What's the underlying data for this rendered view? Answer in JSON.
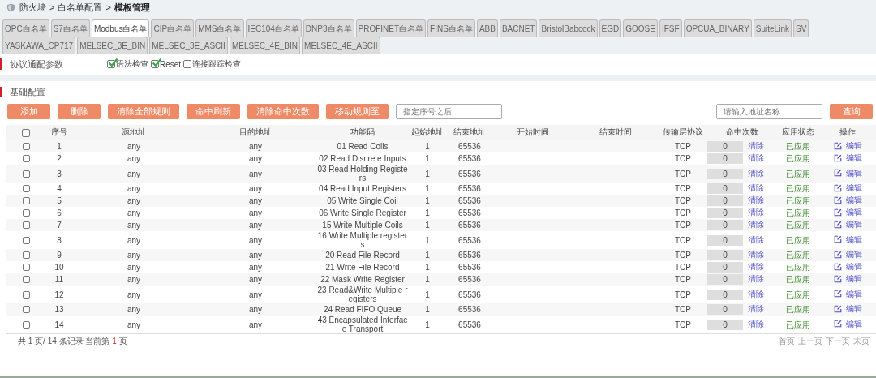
{
  "breadcrumb": {
    "separator": ">",
    "items": [
      {
        "label": "防火墙",
        "current": false
      },
      {
        "label": "白名单配置",
        "current": false
      },
      {
        "label": "模板管理",
        "current": true
      }
    ]
  },
  "tab_rows": [
    [
      {
        "label": "OPC白名单",
        "selected": false
      },
      {
        "label": "S7白名单",
        "selected": false
      },
      {
        "label": "Modbus白名单",
        "selected": true
      },
      {
        "label": "CIP白名单",
        "selected": false
      },
      {
        "label": "MMS白名单",
        "selected": false
      },
      {
        "label": "IEC104白名单",
        "selected": false
      },
      {
        "label": "DNP3白名单",
        "selected": false
      },
      {
        "label": "PROFINET白名单",
        "selected": false
      },
      {
        "label": "FINS白名单",
        "selected": false
      },
      {
        "label": "ABB",
        "selected": false
      },
      {
        "label": "BACNET",
        "selected": false
      },
      {
        "label": "BristolBabcock",
        "selected": false
      },
      {
        "label": "EGD",
        "selected": false
      },
      {
        "label": "GOOSE",
        "selected": false
      },
      {
        "label": "IFSF",
        "selected": false
      },
      {
        "label": "OPCUA_BINARY",
        "selected": false
      },
      {
        "label": "SuiteLink",
        "selected": false
      },
      {
        "label": "SV",
        "selected": false
      }
    ],
    [
      {
        "label": "YASKAWA_CP717",
        "selected": false
      },
      {
        "label": "MELSEC_3E_BIN",
        "selected": false
      },
      {
        "label": "MELSEC_3E_ASCII",
        "selected": false
      },
      {
        "label": "MELSEC_4E_BIN",
        "selected": false
      },
      {
        "label": "MELSEC_4E_ASCII",
        "selected": false
      }
    ]
  ],
  "protocol_params": {
    "title": "协议通配参数",
    "options": [
      {
        "label": "语法检查",
        "checked": true
      },
      {
        "label": "Reset",
        "checked": true
      },
      {
        "label": "连接跟踪检查",
        "checked": false
      }
    ]
  },
  "basic_config": {
    "title": "基础配置",
    "buttons": [
      "添加",
      "删除",
      "清除全部规则",
      "命中刷新",
      "清除命中次数",
      "移动规则至"
    ],
    "position_field": {
      "placeholder": "指定序号之后"
    },
    "search_field": {
      "placeholder": "请输入地址名称"
    },
    "search_button": "查询"
  },
  "table": {
    "select_all": {
      "checked": false
    },
    "columns": [
      "序号",
      "源地址",
      "目的地址",
      "功能码",
      "起始地址",
      "结束地址",
      "开始时间",
      "结束时间",
      "传输层协议",
      "命中次数",
      "应用状态",
      "操作"
    ],
    "rows": [
      {
        "index": "1",
        "source": "any",
        "destination": "any",
        "function_code": "01 Read Coils",
        "checked": false,
        "start_address": "1",
        "end_address": "65536",
        "protocol": "TCP",
        "hits": "0",
        "clear": "清除",
        "status": "已应用",
        "action": "编辑"
      },
      {
        "index": "2",
        "source": "any",
        "destination": "any",
        "function_code": "02 Read Discrete Inputs",
        "checked": false,
        "start_address": "1",
        "end_address": "65536",
        "protocol": "TCP",
        "hits": "0",
        "clear": "清除",
        "status": "已应用",
        "action": "编辑"
      },
      {
        "index": "3",
        "source": "any",
        "destination": "any",
        "function_code": "03 Read Holding Registers",
        "checked": false,
        "start_address": "1",
        "end_address": "65536",
        "protocol": "TCP",
        "hits": "0",
        "clear": "清除",
        "status": "已应用",
        "action": "编辑"
      },
      {
        "index": "4",
        "source": "any",
        "destination": "any",
        "function_code": "04 Read Input Registers",
        "checked": false,
        "start_address": "1",
        "end_address": "65536",
        "protocol": "TCP",
        "hits": "0",
        "clear": "清除",
        "status": "已应用",
        "action": "编辑"
      },
      {
        "index": "5",
        "source": "any",
        "destination": "any",
        "function_code": "05 Write Single Coil",
        "checked": false,
        "start_address": "1",
        "end_address": "65536",
        "protocol": "TCP",
        "hits": "0",
        "clear": "清除",
        "status": "已应用",
        "action": "编辑"
      },
      {
        "index": "6",
        "source": "any",
        "destination": "any",
        "function_code": "06 Write Single Register",
        "checked": false,
        "start_address": "1",
        "end_address": "65536",
        "protocol": "TCP",
        "hits": "0",
        "clear": "清除",
        "status": "已应用",
        "action": "编辑"
      },
      {
        "index": "7",
        "source": "any",
        "destination": "any",
        "function_code": "15 Write Multiple Coils",
        "checked": false,
        "start_address": "1",
        "end_address": "65536",
        "protocol": "TCP",
        "hits": "0",
        "clear": "清除",
        "status": "已应用",
        "action": "编辑"
      },
      {
        "index": "8",
        "source": "any",
        "destination": "any",
        "function_code": "16 Write Multiple registers",
        "checked": false,
        "start_address": "1",
        "end_address": "65536",
        "protocol": "TCP",
        "hits": "0",
        "clear": "清除",
        "status": "已应用",
        "action": "编辑"
      },
      {
        "index": "9",
        "source": "any",
        "destination": "any",
        "function_code": "20 Read File Record",
        "checked": false,
        "start_address": "1",
        "end_address": "65536",
        "protocol": "TCP",
        "hits": "0",
        "clear": "清除",
        "status": "已应用",
        "action": "编辑"
      },
      {
        "index": "10",
        "source": "any",
        "destination": "any",
        "function_code": "21 Write File Record",
        "checked": false,
        "start_address": "1",
        "end_address": "65536",
        "protocol": "TCP",
        "hits": "0",
        "clear": "清除",
        "status": "已应用",
        "action": "编辑"
      },
      {
        "index": "11",
        "source": "any",
        "destination": "any",
        "function_code": "22 Mask Write Register",
        "checked": false,
        "start_address": "1",
        "end_address": "65536",
        "protocol": "TCP",
        "hits": "0",
        "clear": "清除",
        "status": "已应用",
        "action": "编辑"
      },
      {
        "index": "12",
        "source": "any",
        "destination": "any",
        "function_code": "23 Read&Write Multiple registers",
        "checked": false,
        "start_address": "1",
        "end_address": "65536",
        "protocol": "TCP",
        "hits": "0",
        "clear": "清除",
        "status": "已应用",
        "action": "编辑"
      },
      {
        "index": "13",
        "source": "any",
        "destination": "any",
        "function_code": "24 Read FIFO Queue",
        "checked": false,
        "start_address": "1",
        "end_address": "65536",
        "protocol": "TCP",
        "hits": "0",
        "clear": "清除",
        "status": "已应用",
        "action": "编辑"
      },
      {
        "index": "14",
        "source": "any",
        "destination": "any",
        "function_code": "43 Encapsulated Interface Transport",
        "checked": false,
        "start_address": "1",
        "end_address": "65536",
        "protocol": "TCP",
        "hits": "0",
        "clear": "清除",
        "status": "已应用",
        "action": "编辑"
      }
    ]
  },
  "footer": {
    "summary": "共 1 页/ 14 条记录 当前第",
    "current_page": "1",
    "page_unit": "页",
    "pager": [
      "首页",
      "上一页",
      "下一页",
      "末页"
    ]
  }
}
